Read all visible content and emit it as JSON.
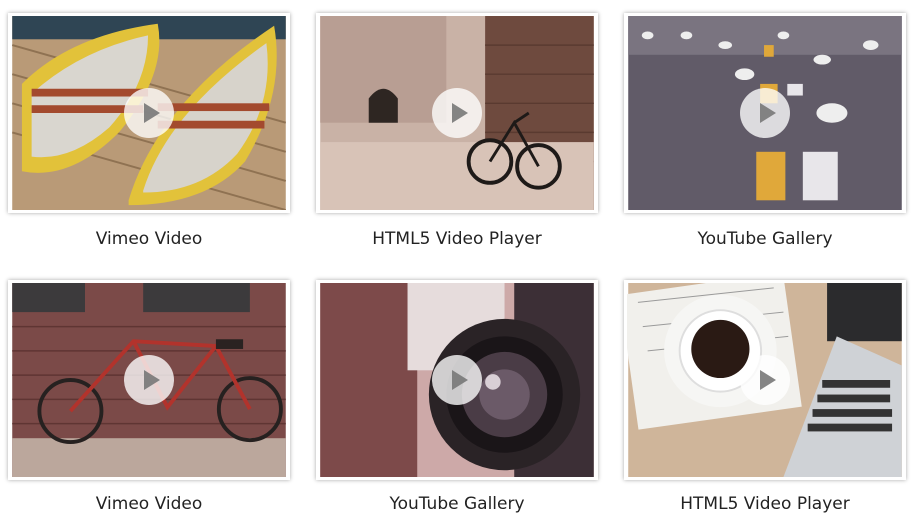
{
  "gallery": {
    "items": [
      {
        "title": "Vimeo Video",
        "scene": "rowboats on dock"
      },
      {
        "title": "HTML5 Video Player",
        "scene": "bicycle in stone alley"
      },
      {
        "title": "YouTube Gallery",
        "scene": "seagulls on road"
      },
      {
        "title": "Vimeo Video",
        "scene": "red bicycle by brick wall"
      },
      {
        "title": "YouTube Gallery",
        "scene": "camera lens close-up"
      },
      {
        "title": "HTML5 Video Player",
        "scene": "coffee cup and laptop on desk"
      }
    ]
  }
}
